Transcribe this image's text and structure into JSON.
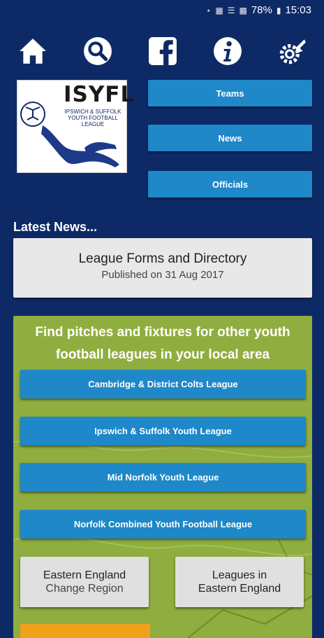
{
  "status": {
    "battery": "78%",
    "time": "15:03"
  },
  "toolbar": {
    "icons": [
      "home-icon",
      "search-icon",
      "facebook-icon",
      "info-icon",
      "settings-icon"
    ]
  },
  "logo": {
    "title": "ISYFL",
    "subtitle": "IPSWICH & SUFFOLK YOUTH FOOTBALL LEAGUE"
  },
  "side_menu": [
    "Teams",
    "News",
    "Officials"
  ],
  "latest": {
    "heading": "Latest News...",
    "title": "League Forms and Directory",
    "date": "Published on 31 Aug 2017"
  },
  "panel": {
    "heading": "Find pitches and fixtures for other youth football leagues in your local area",
    "leagues": [
      "Cambridge & District Colts League",
      "Ipswich & Suffolk Youth League",
      "Mid Norfolk Youth League",
      "Norfolk Combined Youth Football League"
    ],
    "region": {
      "title": "Eastern England",
      "action": "Change Region"
    },
    "leagues_in": {
      "line1": "Leagues in",
      "line2": "Eastern England"
    }
  },
  "colors": {
    "background": "#0d2a66",
    "button": "#1e88c8",
    "panel": "#8fae3f",
    "orange": "#f2a21a"
  }
}
